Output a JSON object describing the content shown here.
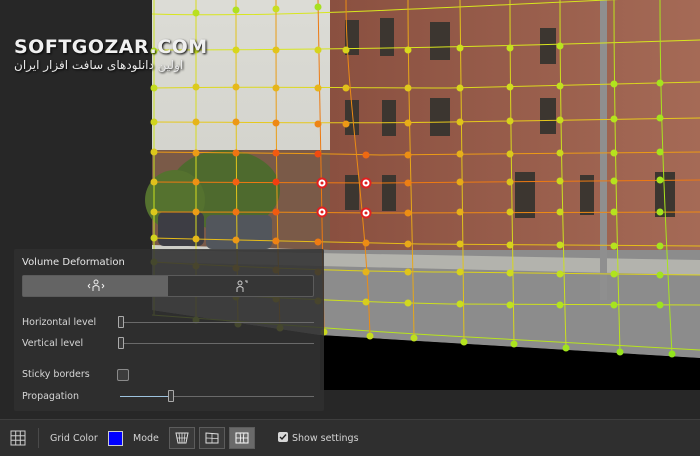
{
  "watermark": {
    "brand": "SOFTGOZAR.COM",
    "tagline": "اولین دانلودهای سافت افزار ایران"
  },
  "panel": {
    "title": "Volume Deformation",
    "mode_buttons": [
      {
        "icon": "person-expand-icon",
        "active": true
      },
      {
        "icon": "person-move-icon",
        "active": false
      }
    ],
    "horizontal_label": "Horizontal level",
    "vertical_label": "Vertical level",
    "sticky_label": "Sticky borders",
    "sticky_checked": false,
    "propagation_label": "Propagation",
    "propagation_value": 0.26,
    "horizontal_value": 0,
    "vertical_value": 0
  },
  "bottom_bar": {
    "grid_icon": "grid-icon",
    "grid_color_label": "Grid Color",
    "grid_color": "#0000ff",
    "mode_label": "Mode",
    "modes": [
      {
        "icon": "perspective-grid-icon",
        "active": false
      },
      {
        "icon": "flat-grid-icon",
        "active": false
      },
      {
        "icon": "warp-grid-icon",
        "active": true
      }
    ],
    "show_settings_label": "Show settings",
    "show_settings_checked": true
  },
  "colors": {
    "grid_green": "#9be22a",
    "grid_yellow": "#e8e81e",
    "grid_orange": "#f08a10",
    "grid_red": "#e82010",
    "slider_accent": "#9ec3df"
  }
}
